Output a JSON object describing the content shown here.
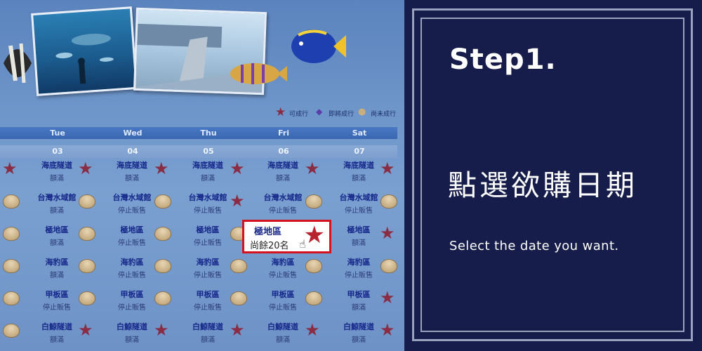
{
  "step": {
    "title": "Step1.",
    "instruction_zh": "點選欲購日期",
    "instruction_en": "Select the date you want."
  },
  "legend": {
    "available": "可成行",
    "almost_full": "即將成行",
    "not_available": "尚未成行"
  },
  "days": [
    "Tue",
    "Wed",
    "Thu",
    "Fri",
    "Sat"
  ],
  "dates": [
    "03",
    "04",
    "05",
    "06",
    "07"
  ],
  "rows": [
    {
      "name": "海底隧道",
      "status": [
        "額滿",
        "額滿",
        "額滿",
        "額滿",
        "額滿"
      ]
    },
    {
      "name": "台灣水域館",
      "status": [
        "額滿",
        "停止販售",
        "停止販售",
        "停止販售",
        "停止販售"
      ]
    },
    {
      "name": "極地區",
      "status": [
        "額滿",
        "停止販售",
        "停止販售",
        "",
        "額滿"
      ]
    },
    {
      "name": "海豹區",
      "status": [
        "額滿",
        "停止販售",
        "停止販售",
        "停止販售",
        "停止販售"
      ]
    },
    {
      "name": "甲板區",
      "status": [
        "停止販售",
        "停止販售",
        "停止販售",
        "停止販售",
        "額滿"
      ]
    },
    {
      "name": "白鯨隧道",
      "status": [
        "額滿",
        "額滿",
        "額滿",
        "額滿",
        "額滿"
      ]
    }
  ],
  "highlight": {
    "name": "極地區",
    "remaining": "尚餘20名"
  },
  "colors": {
    "accent_red": "#d4111d",
    "panel_navy": "#161d4a",
    "frame_gray": "#9aa3bd"
  }
}
